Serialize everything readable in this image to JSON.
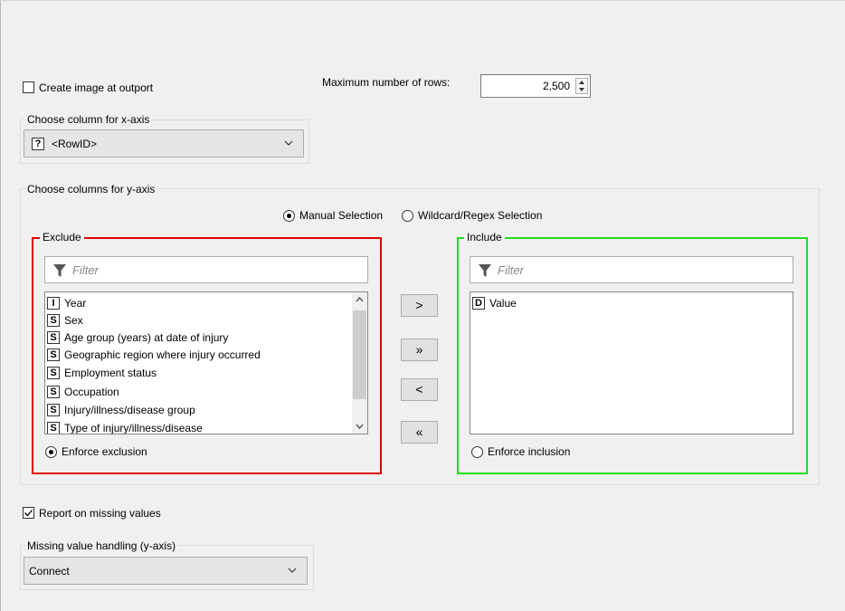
{
  "create_image": {
    "label": "Create image at outport",
    "checked": false
  },
  "max_rows": {
    "label": "Maximum number of rows:",
    "value": "2,500"
  },
  "x_axis": {
    "group_title": "Choose column for x-axis",
    "type_badge": "?",
    "selected": "<RowID>"
  },
  "y_axis": {
    "group_title": "Choose columns for y-axis",
    "mode_manual": "Manual Selection",
    "mode_wildcard": "Wildcard/Regex Selection",
    "exclude": {
      "title": "Exclude",
      "filter_placeholder": "Filter",
      "items": [
        {
          "type": "I",
          "label": "Year"
        },
        {
          "type": "S",
          "label": "Sex"
        },
        {
          "type": "S",
          "label": "Age group (years) at date of injury"
        },
        {
          "type": "S",
          "label": "Geographic region where injury occurred"
        },
        {
          "type": "S",
          "label": "Employment status"
        },
        {
          "type": "S",
          "label": "Occupation"
        },
        {
          "type": "S",
          "label": "Injury/illness/disease group"
        },
        {
          "type": "S",
          "label": "Type of injury/illness/disease"
        }
      ],
      "enforce_label": "Enforce exclusion"
    },
    "include": {
      "title": "Include",
      "filter_placeholder": "Filter",
      "items": [
        {
          "type": "D",
          "label": "Value"
        }
      ],
      "enforce_label": "Enforce inclusion"
    },
    "buttons": {
      "add": ">",
      "add_all": "»",
      "remove": "<",
      "remove_all": "«"
    }
  },
  "report_missing": {
    "label": "Report on missing values",
    "checked": true
  },
  "missing_handling": {
    "group_title": "Missing value handling (y-axis)",
    "selected": "Connect"
  }
}
